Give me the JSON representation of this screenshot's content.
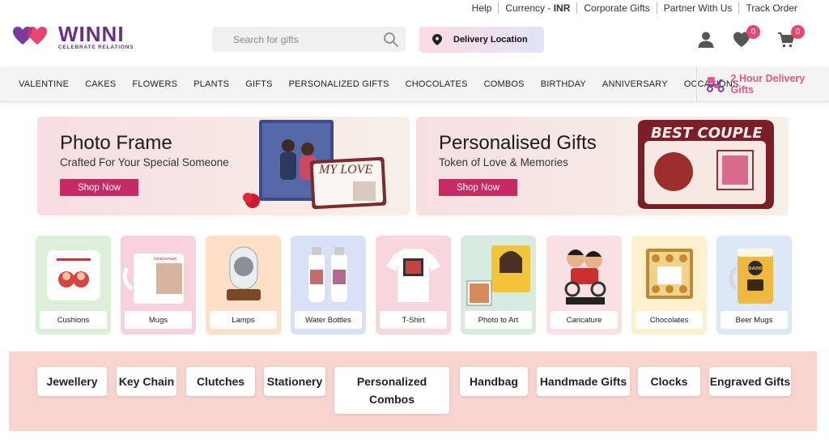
{
  "top_links": [
    "Help",
    "Currency -",
    "INR",
    "Corporate Gifts",
    "Partner With Us",
    "Track Order"
  ],
  "logo": {
    "brand": "WINNI",
    "tagline": "CELEBRATE RELATIONS"
  },
  "search": {
    "placeholder": "Search for gifts",
    "icon": "magnifier-icon"
  },
  "delivery": {
    "label": "Delivery Location",
    "icon": "location-pin-icon"
  },
  "header_icons": {
    "account": "user-icon",
    "wishlist": {
      "icon": "heart-icon",
      "count": "0"
    },
    "cart": {
      "icon": "cart-icon",
      "count": "0"
    }
  },
  "nav": {
    "items": [
      "VALENTINE",
      "CAKES",
      "FLOWERS",
      "PLANTS",
      "GIFTS",
      "PERSONALIZED GIFTS",
      "CHOCOLATES",
      "COMBOS",
      "BIRTHDAY",
      "ANNIVERSARY",
      "OCCASIONS"
    ],
    "express": "2 Hour Delivery Gifts"
  },
  "banners": [
    {
      "title": "Photo Frame",
      "subtitle": "Crafted For Your Special Someone",
      "button": "Shop Now",
      "art_text": "MY LOVE"
    },
    {
      "title": "Personalised Gifts",
      "subtitle": "Token of Love & Memories",
      "button": "Shop Now",
      "art_text": "BEST COUPLE"
    }
  ],
  "categories": [
    {
      "label": "Cushions",
      "bg": "#dcefd9"
    },
    {
      "label": "Mugs",
      "bg": "#f7d2dc"
    },
    {
      "label": "Lamps",
      "bg": "#fde0c7"
    },
    {
      "label": "Water Bottles",
      "bg": "#d9e1f7"
    },
    {
      "label": "T-Shirt",
      "bg": "#f8d6de"
    },
    {
      "label": "Photo to Art",
      "bg": "#d7ecdf"
    },
    {
      "label": "Caricature",
      "bg": "#fae0e3"
    },
    {
      "label": "Chocolates",
      "bg": "#fdf0cd"
    },
    {
      "label": "Beer Mugs",
      "bg": "#dbe8f7"
    }
  ],
  "tags": [
    "Jewellery",
    "Key Chain",
    "Clutches",
    "Stationery",
    "Personalized Combos",
    "Handbag",
    "Handmade Gifts",
    "Clocks",
    "Engraved Gifts"
  ],
  "colors": {
    "brand": "#6b2f8a",
    "accent": "#e8466f",
    "button": "#c62a62",
    "tags_bg": "#f8d4cf"
  }
}
